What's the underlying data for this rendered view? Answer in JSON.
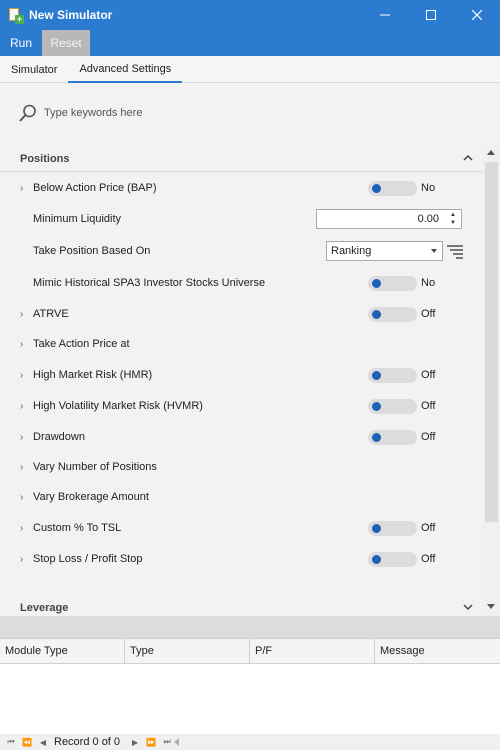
{
  "window": {
    "title": "New Simulator"
  },
  "menu": {
    "run_label": "Run",
    "reset_label": "Reset"
  },
  "tabs": [
    {
      "label": "Simulator"
    },
    {
      "label": "Advanced Settings"
    }
  ],
  "search": {
    "placeholder": "Type keywords here"
  },
  "positions": {
    "header": "Positions",
    "rows": [
      {
        "label": "Below Action Price (BAP)",
        "value": "No"
      },
      {
        "label": "Minimum Liquidity",
        "value": "0.00"
      },
      {
        "label": "Take Position Based On",
        "value": "Ranking"
      },
      {
        "label": "Mimic Historical SPA3 Investor Stocks Universe",
        "value": "No"
      },
      {
        "label": "ATRVE",
        "value": "Off"
      },
      {
        "label": "Take Action Price at"
      },
      {
        "label": "High Market Risk (HMR)",
        "value": "Off"
      },
      {
        "label": "High Volatility Market Risk (HVMR)",
        "value": "Off"
      },
      {
        "label": "Drawdown",
        "value": "Off"
      },
      {
        "label": "Vary Number of Positions"
      },
      {
        "label": "Vary Brokerage Amount"
      },
      {
        "label": "Custom % To TSL",
        "value": "Off"
      },
      {
        "label": "Stop Loss / Profit Stop",
        "value": "Off"
      }
    ]
  },
  "leverage": {
    "header": "Leverage"
  },
  "grid": {
    "columns": [
      "Module Type",
      "Type",
      "P/F",
      "Message"
    ]
  },
  "navigator": {
    "record_text": "Record 0 of 0"
  },
  "colors": {
    "accent": "#2b7bd1",
    "toggle_knob": "#1c62b9"
  }
}
